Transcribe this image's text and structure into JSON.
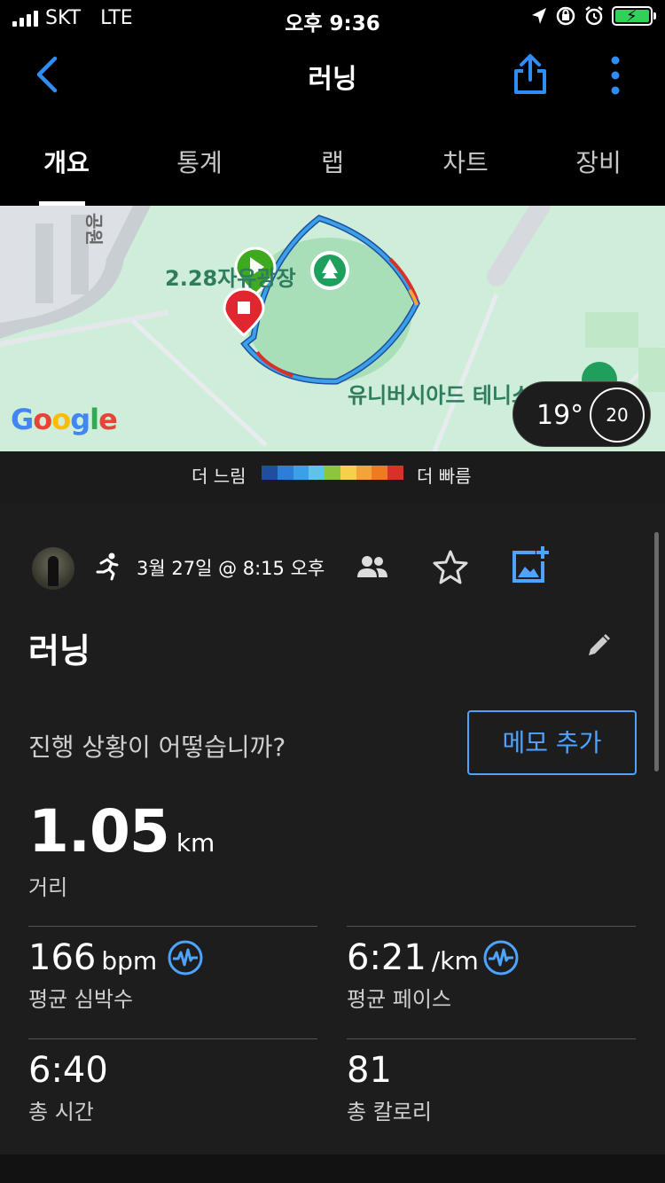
{
  "status_bar": {
    "carrier": "SKT",
    "network": "LTE",
    "time": "오후 9:36"
  },
  "nav": {
    "title": "러닝"
  },
  "tabs": [
    {
      "label": "개요",
      "active": true
    },
    {
      "label": "통계",
      "active": false
    },
    {
      "label": "랩",
      "active": false
    },
    {
      "label": "차트",
      "active": false
    },
    {
      "label": "장비",
      "active": false
    }
  ],
  "map": {
    "place_label_1": "2.28자유광장",
    "place_label_2": "유니버시아드 테니스장",
    "road_label": "공원",
    "provider": "Google",
    "temperature": "19°",
    "wind": "20"
  },
  "legend": {
    "slow": "더 느림",
    "fast": "더 빠름",
    "colors": [
      "#1f4e9e",
      "#2e7dd6",
      "#3aa0e8",
      "#5fc2e8",
      "#8cc63f",
      "#f5d04a",
      "#f2a33a",
      "#ee7a22",
      "#d9302a"
    ]
  },
  "activity": {
    "date": "3월 27일 @ 8:15 오후",
    "title": "러닝",
    "prompt": "진행 상황이 어떻습니까?",
    "memo_button": "메모 추가"
  },
  "distance": {
    "value": "1.05",
    "unit": "km",
    "label": "거리"
  },
  "stats": {
    "heart_rate": {
      "value": "166",
      "unit": "bpm",
      "label": "평균 심박수"
    },
    "pace": {
      "value": "6:21",
      "unit": "/km",
      "label": "평균 페이스"
    },
    "time": {
      "value": "6:40",
      "label": "총 시간"
    },
    "calories": {
      "value": "81",
      "label": "총 칼로리"
    }
  },
  "colors": {
    "accent": "#4da3ff",
    "start_marker": "#3faa1f",
    "stop_marker": "#e0262e",
    "map_bg": "#cfeed9"
  }
}
